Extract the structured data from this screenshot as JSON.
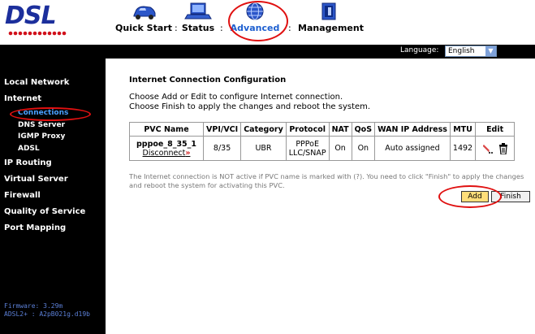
{
  "header": {
    "logo_text": "DSL",
    "nav": [
      {
        "label": "Quick Start",
        "icon": "car-icon"
      },
      {
        "label": "Status",
        "icon": "laptop-icon"
      },
      {
        "label": "Advanced",
        "icon": "globe-icon"
      },
      {
        "label": "Management",
        "icon": "document-icon"
      }
    ],
    "separator": ":"
  },
  "language": {
    "label": "Language:",
    "selected": "English"
  },
  "sidebar": {
    "items": [
      {
        "label": "Local Network"
      },
      {
        "label": "Internet"
      },
      {
        "label": "IP Routing"
      },
      {
        "label": "Virtual Server"
      },
      {
        "label": "Firewall"
      },
      {
        "label": "Quality of Service"
      },
      {
        "label": "Port Mapping"
      }
    ],
    "internet_sub": [
      {
        "label": "Connections"
      },
      {
        "label": "DNS Server"
      },
      {
        "label": "IGMP Proxy"
      },
      {
        "label": "ADSL"
      }
    ],
    "firmware": "Firmware: 3.29m",
    "adsl_version": "ADSL2+ : A2pB021g.d19b"
  },
  "main": {
    "title": "Internet Connection Configuration",
    "instructions": [
      "Choose Add or Edit to configure Internet connection.",
      "Choose Finish to apply the changes and reboot the system."
    ],
    "table": {
      "headers": [
        "PVC Name",
        "VPI/VCI",
        "Category",
        "Protocol",
        "NAT",
        "QoS",
        "WAN IP Address",
        "MTU",
        "Edit"
      ],
      "rows": [
        {
          "pvc_name": "pppoe_8_35_1",
          "action": "Disconnect",
          "vpi_vci": "8/35",
          "category": "UBR",
          "protocol_line1": "PPPoE",
          "protocol_line2": "LLC/SNAP",
          "nat": "On",
          "qos": "On",
          "wan_ip": "Auto assigned",
          "mtu": "1492"
        }
      ]
    },
    "note": "The Internet connection is NOT active if PVC name is marked with (?). You need to click \"Finish\" to apply the changes and reboot the system for activating this PVC.",
    "add_label": "Add",
    "finish_label": "Finish"
  },
  "colors": {
    "accent": "#1d5fd0",
    "highlight": "#e01010",
    "sidebar_bg": "#000000",
    "add_button": "#ffde7a"
  }
}
